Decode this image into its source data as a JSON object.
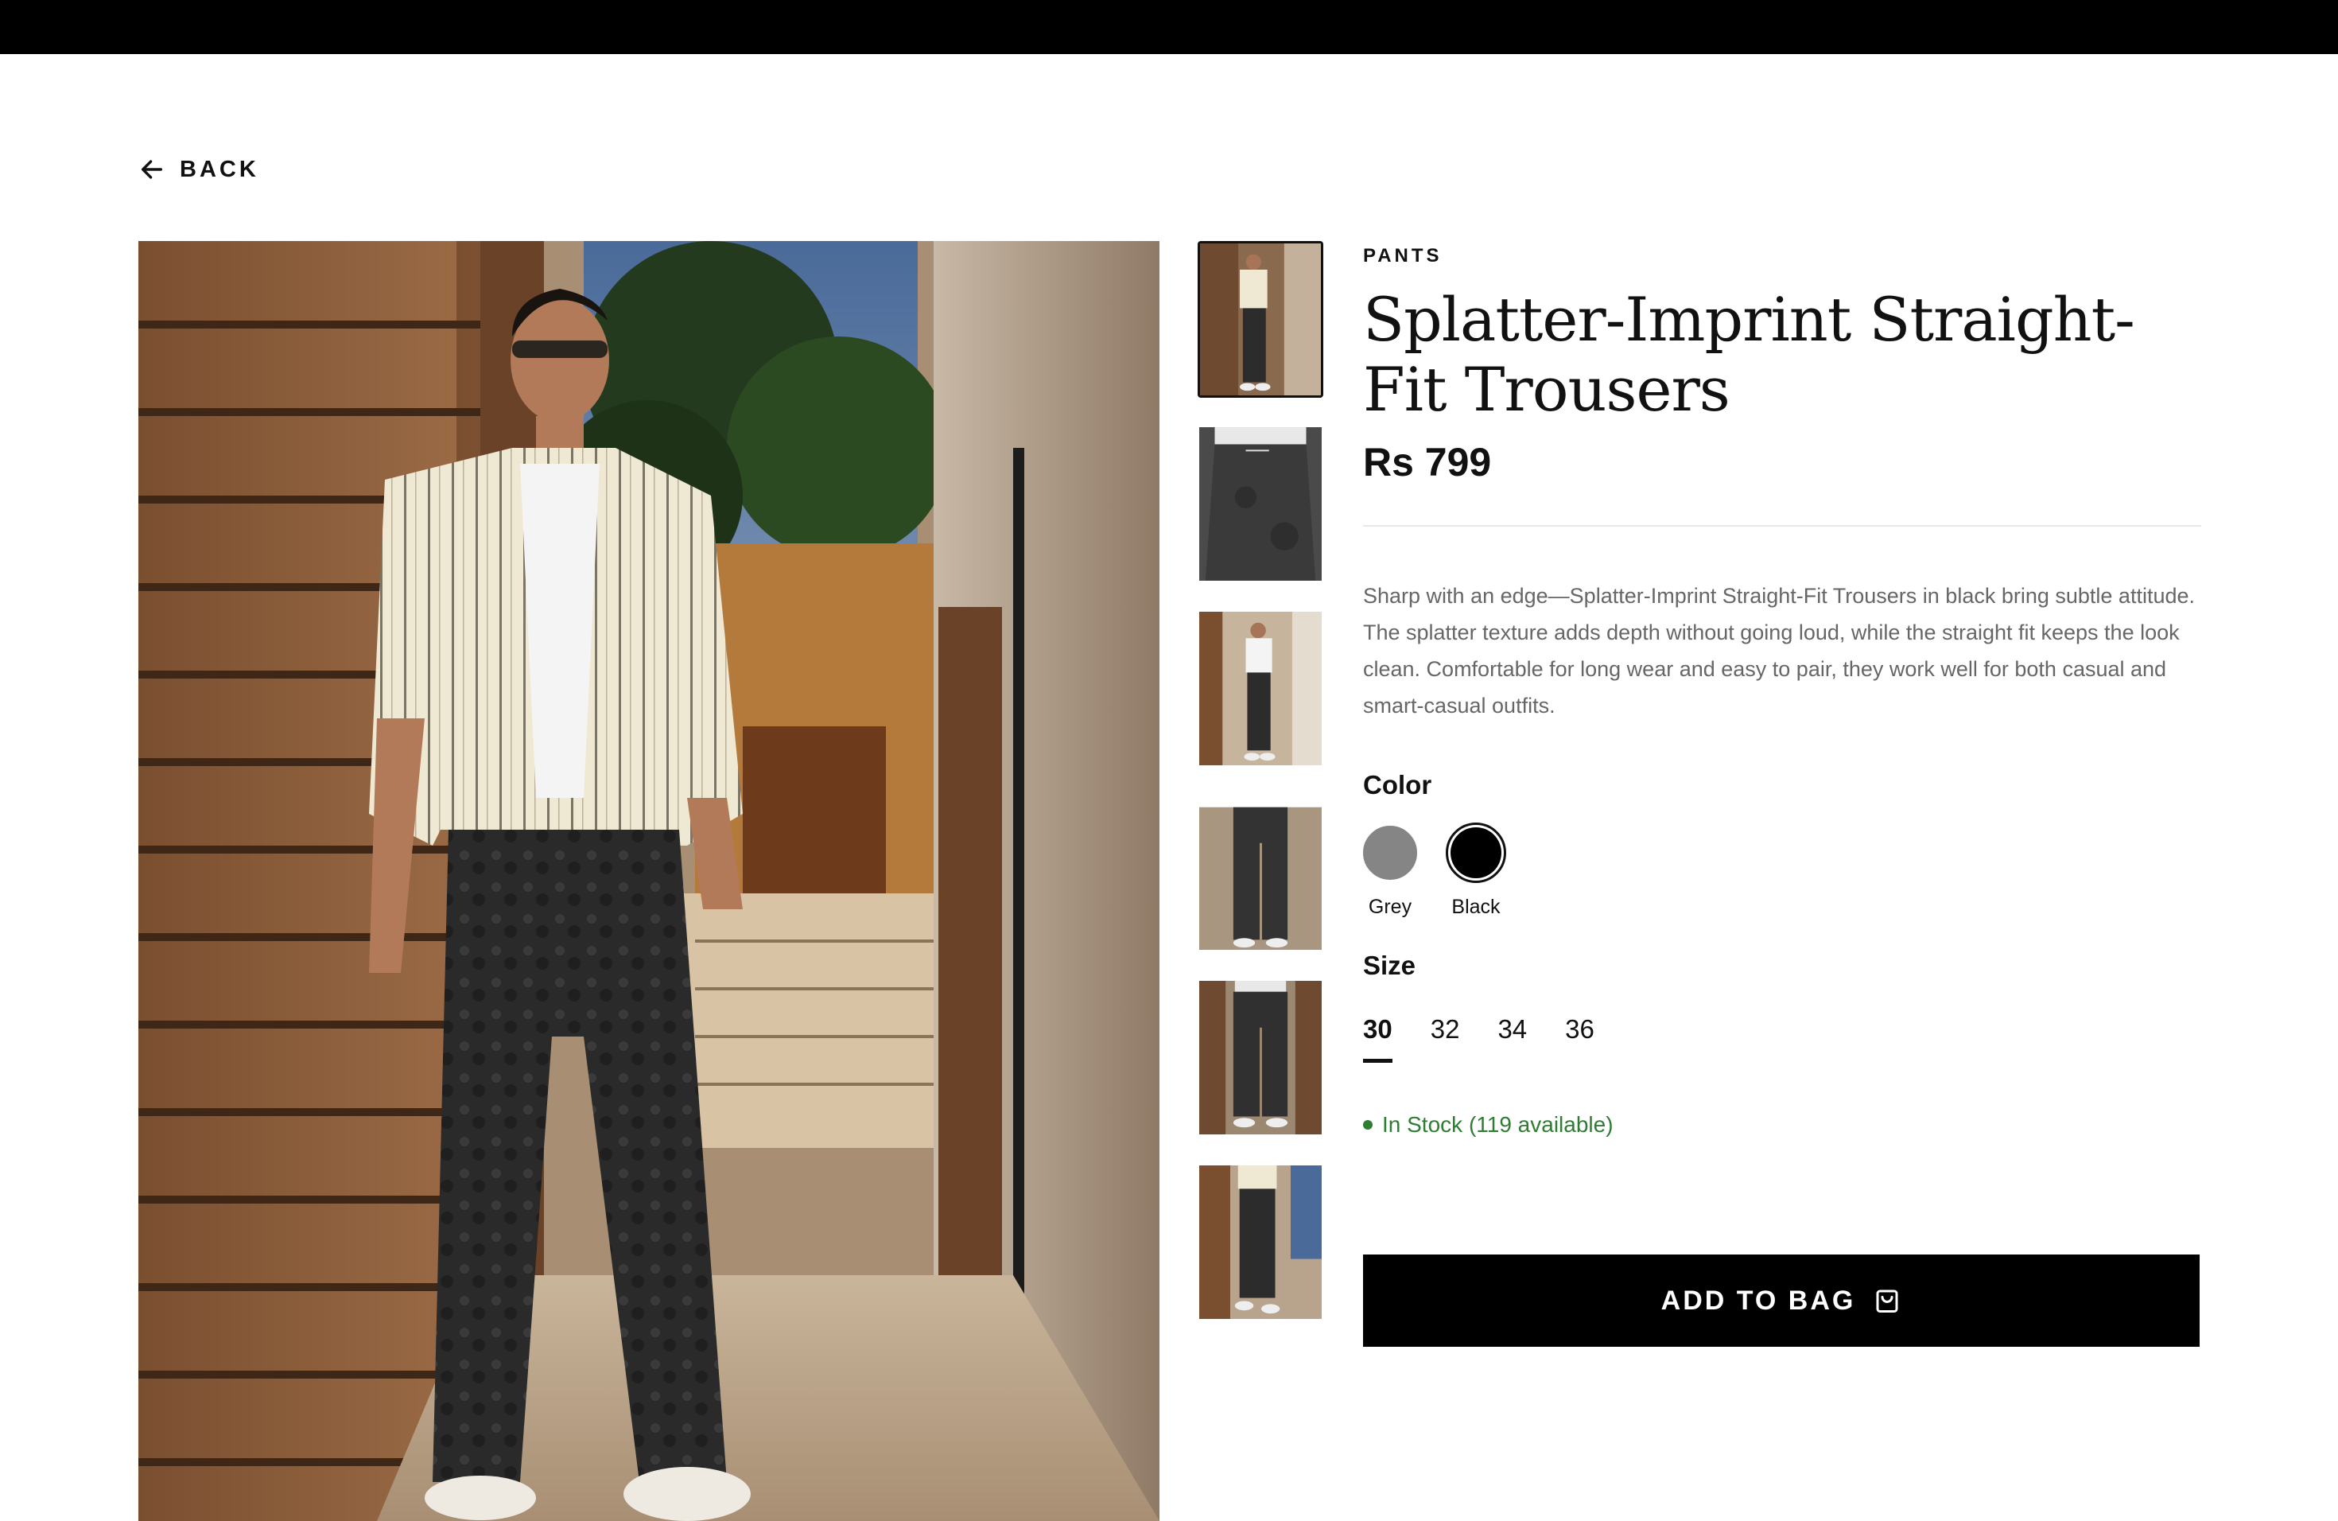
{
  "nav": {
    "back_label": "BACK"
  },
  "product": {
    "category": "PANTS",
    "title": "Splatter-Imprint Straight-Fit Trousers",
    "price": "Rs 799",
    "description": "Sharp with an edge—Splatter-Imprint Straight-Fit Trousers in black bring subtle attitude. The splatter texture adds depth without going loud, while the straight fit keeps the look clean. Comfortable for long wear and easy to pair, they work well for both casual and smart-casual outfits."
  },
  "color": {
    "label": "Color",
    "options": [
      {
        "name": "Grey",
        "hex": "#858585"
      },
      {
        "name": "Black",
        "hex": "#000000"
      }
    ],
    "selected": "Black"
  },
  "size": {
    "label": "Size",
    "options": [
      "30",
      "32",
      "34",
      "36"
    ],
    "selected": "30"
  },
  "stock": {
    "text": "In Stock (119 available)",
    "color": "#2e7d32"
  },
  "cta": {
    "label": "ADD TO BAG",
    "icon": "shopping-bag-icon"
  },
  "gallery": {
    "thumbnail_count": 6,
    "active_index": 0
  },
  "colors": {
    "topbar": "#000000",
    "button": "#000000",
    "text": "#111111",
    "muted": "#666666"
  }
}
